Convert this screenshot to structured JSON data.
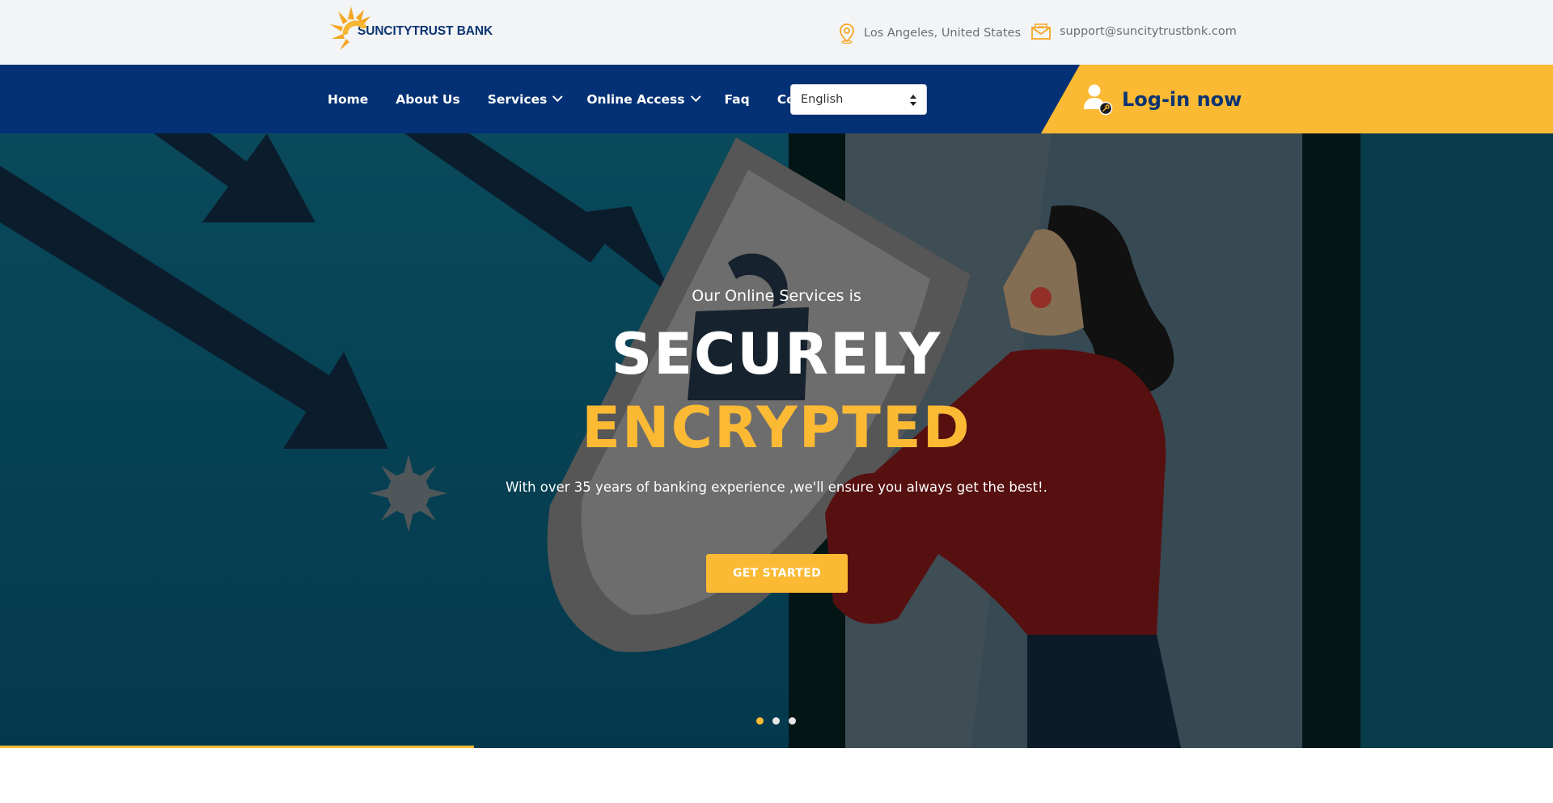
{
  "brand": {
    "name": "SUNCITYTRUST BANK",
    "logo_icon": "sun-logo-icon",
    "colors": {
      "navy": "#043175",
      "gold": "#fbb934"
    }
  },
  "topbar": {
    "location": {
      "icon": "map-pin-icon",
      "text": "Los Angeles, United States"
    },
    "email": {
      "icon": "envelope-icon",
      "text": "support@suncitytrustbnk.com"
    }
  },
  "nav": {
    "items": [
      {
        "label": "Home",
        "has_dropdown": false
      },
      {
        "label": "About Us",
        "has_dropdown": false
      },
      {
        "label": "Services",
        "has_dropdown": true
      },
      {
        "label": "Online Access",
        "has_dropdown": true
      },
      {
        "label": "Faq",
        "has_dropdown": false
      },
      {
        "label": "Contact",
        "has_dropdown": false
      }
    ],
    "language": {
      "selected": "English"
    },
    "login": {
      "label": "Log-in now",
      "icon": "user-key-icon"
    }
  },
  "hero": {
    "subtitle": "Our Online Services is",
    "title_line1": "SECURELY",
    "title_line2": "ENCRYPTED",
    "description": "With over 35 years of banking experience ,we'll ensure you always get the best!.",
    "cta_label": "GET STARTED",
    "slides_count": 3,
    "active_slide": 1
  }
}
